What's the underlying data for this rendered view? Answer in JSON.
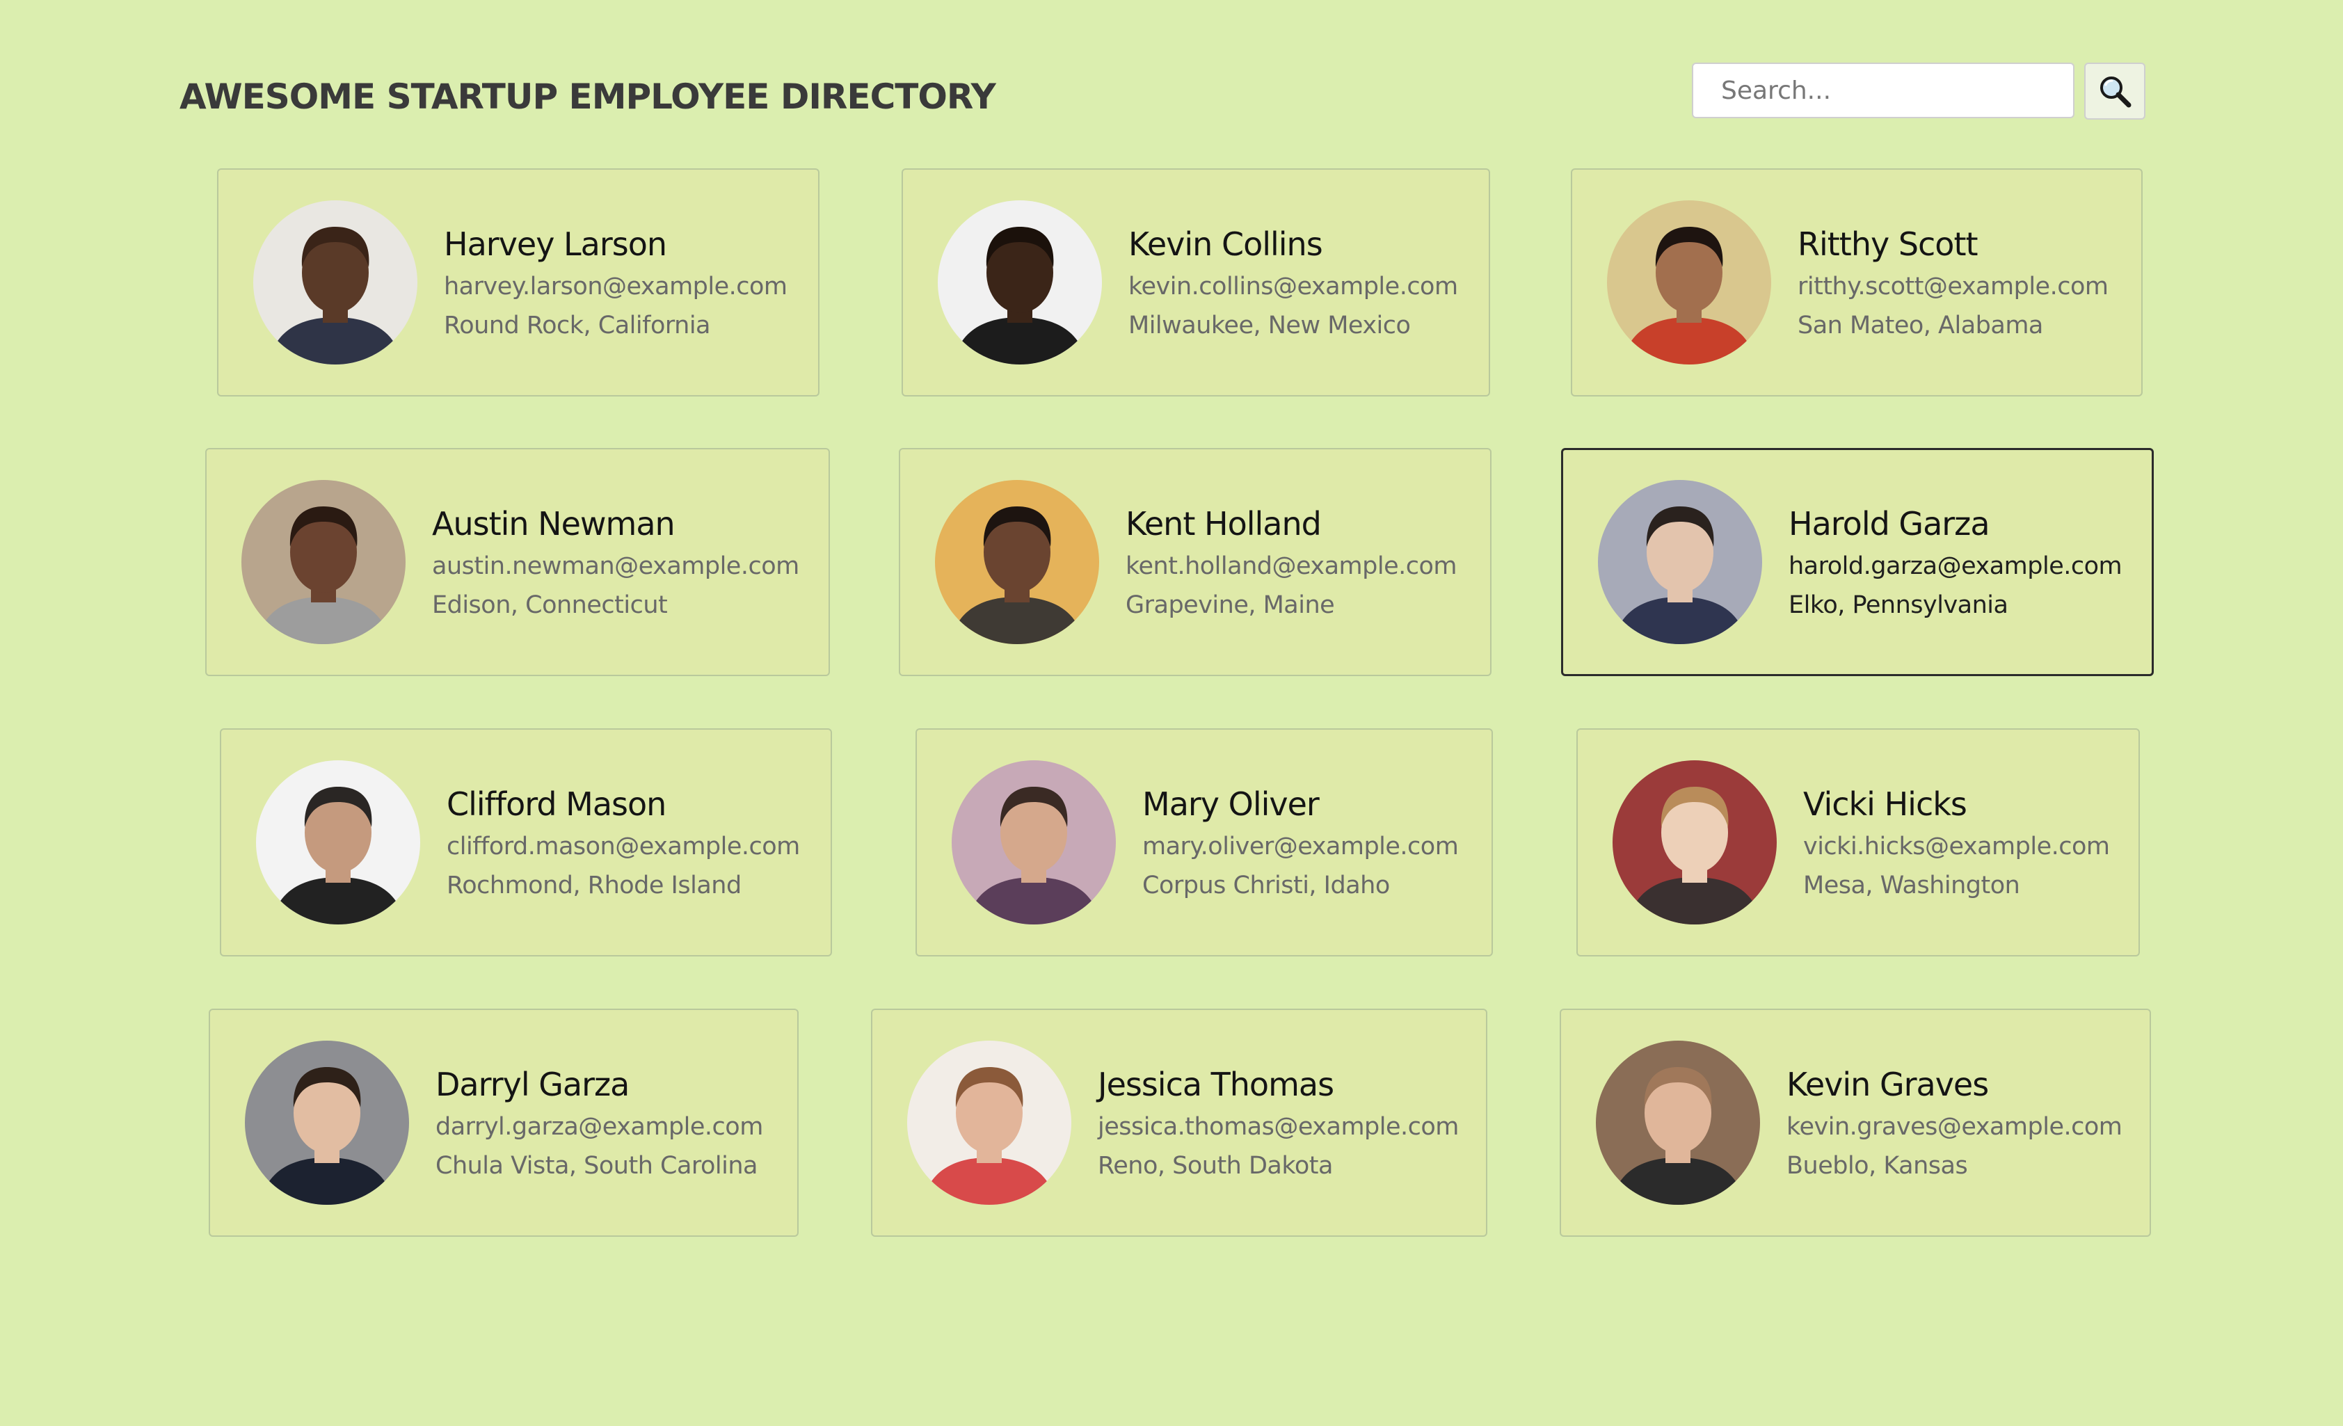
{
  "header": {
    "title": "AWESOME STARTUP EMPLOYEE DIRECTORY",
    "search_placeholder": "Search...",
    "search_icon": "magnifier-icon"
  },
  "employees": [
    {
      "name": "Harvey Larson",
      "email": "harvey.larson@example.com",
      "location": "Round Rock, California",
      "avatar": {
        "bg": "#e9e7e2",
        "skin": "#5a3a28",
        "hair": "#3a2418",
        "shirt": "#2f3447"
      }
    },
    {
      "name": "Kevin Collins",
      "email": "kevin.collins@example.com",
      "location": "Milwaukee, New Mexico",
      "avatar": {
        "bg": "#f1f1f1",
        "skin": "#3b2518",
        "hair": "#1b110b",
        "shirt": "#1c1c1c"
      }
    },
    {
      "name": "Ritthy Scott",
      "email": "ritthy.scott@example.com",
      "location": "San Mateo, Alabama",
      "avatar": {
        "bg": "#d9c78e",
        "skin": "#a26f4e",
        "hair": "#1e1410",
        "shirt": "#c8402a"
      }
    },
    {
      "name": "Austin Newman",
      "email": "austin.newman@example.com",
      "location": "Edison, Connecticut",
      "avatar": {
        "bg": "#b8a58d",
        "skin": "#6b4330",
        "hair": "#2a1a12",
        "shirt": "#9d9d9d"
      }
    },
    {
      "name": "Kent Holland",
      "email": "kent.holland@example.com",
      "location": "Grapevine, Maine",
      "avatar": {
        "bg": "#e5b35a",
        "skin": "#6a4430",
        "hair": "#1d1410",
        "shirt": "#3f3a34"
      }
    },
    {
      "name": "Harold Garza",
      "email": "harold.garza@example.com",
      "location": "Elko, Pennsylvania",
      "avatar": {
        "bg": "#a7aab8",
        "skin": "#e3c4ad",
        "hair": "#2a221e",
        "shirt": "#2f3550"
      }
    },
    {
      "name": "Clifford Mason",
      "email": "clifford.mason@example.com",
      "location": "Rochmond, Rhode Island",
      "avatar": {
        "bg": "#f3f3f3",
        "skin": "#c59a7e",
        "hair": "#2a2624",
        "shirt": "#222222"
      }
    },
    {
      "name": "Mary Oliver",
      "email": "mary.oliver@example.com",
      "location": "Corpus Christi, Idaho",
      "avatar": {
        "bg": "#c7a9b7",
        "skin": "#d5a88c",
        "hair": "#3a2a24",
        "shirt": "#5b3e5a"
      }
    },
    {
      "name": "Vicki Hicks",
      "email": "vicki.hicks@example.com",
      "location": "Mesa, Washington",
      "avatar": {
        "bg": "#9b3b3a",
        "skin": "#edd0b8",
        "hair": "#b98c5a",
        "shirt": "#3a3030"
      }
    },
    {
      "name": "Darryl Garza",
      "email": "darryl.garza@example.com",
      "location": "Chula Vista, South Carolina",
      "avatar": {
        "bg": "#8d8e92",
        "skin": "#e2bda2",
        "hair": "#2e2119",
        "shirt": "#1c2230"
      }
    },
    {
      "name": "Jessica Thomas",
      "email": "jessica.thomas@example.com",
      "location": "Reno, South Dakota",
      "avatar": {
        "bg": "#f2ede7",
        "skin": "#e2b59a",
        "hair": "#8b5a3a",
        "shirt": "#d84a4a"
      }
    },
    {
      "name": "Kevin Graves",
      "email": "kevin.graves@example.com",
      "location": "Bueblo, Kansas",
      "avatar": {
        "bg": "#8a6d56",
        "skin": "#e0b69a",
        "hair": "#a0785a",
        "shirt": "#2b2b2b"
      }
    }
  ],
  "active_index": 5
}
